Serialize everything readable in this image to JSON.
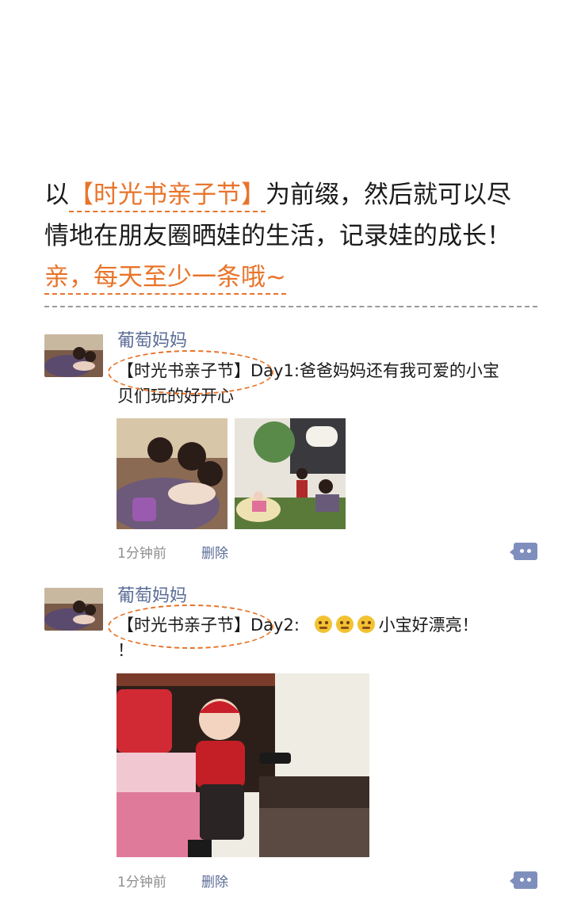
{
  "intro": {
    "line1_pre": "以",
    "line1_tag": "【时光书亲子节】",
    "line1_post": "为前缀，然后就可以尽",
    "line2": "情地在朋友圈晒娃的生活，记录娃的成长！",
    "line3": "亲，每天至少一条哦~"
  },
  "posts": [
    {
      "name": "葡萄妈妈",
      "tag": "【时光书亲子节】",
      "text": "Day1:爸爸妈妈还有我可爱的小宝贝们玩的好开心",
      "time": "1分钟前",
      "delete": "删除"
    },
    {
      "name": "葡萄妈妈",
      "tag": "【时光书亲子节】",
      "text_pre": "Day2:",
      "text_post": "小宝好漂亮！",
      "text_line2": "！",
      "time": "1分钟前",
      "delete": "删除"
    }
  ],
  "colors": {
    "accent": "#e8742a",
    "link": "#5a6b96",
    "icon": "#7f8fbd"
  },
  "icons": {
    "comment": "comment-icon",
    "emoji": "thinking-face-icon"
  }
}
